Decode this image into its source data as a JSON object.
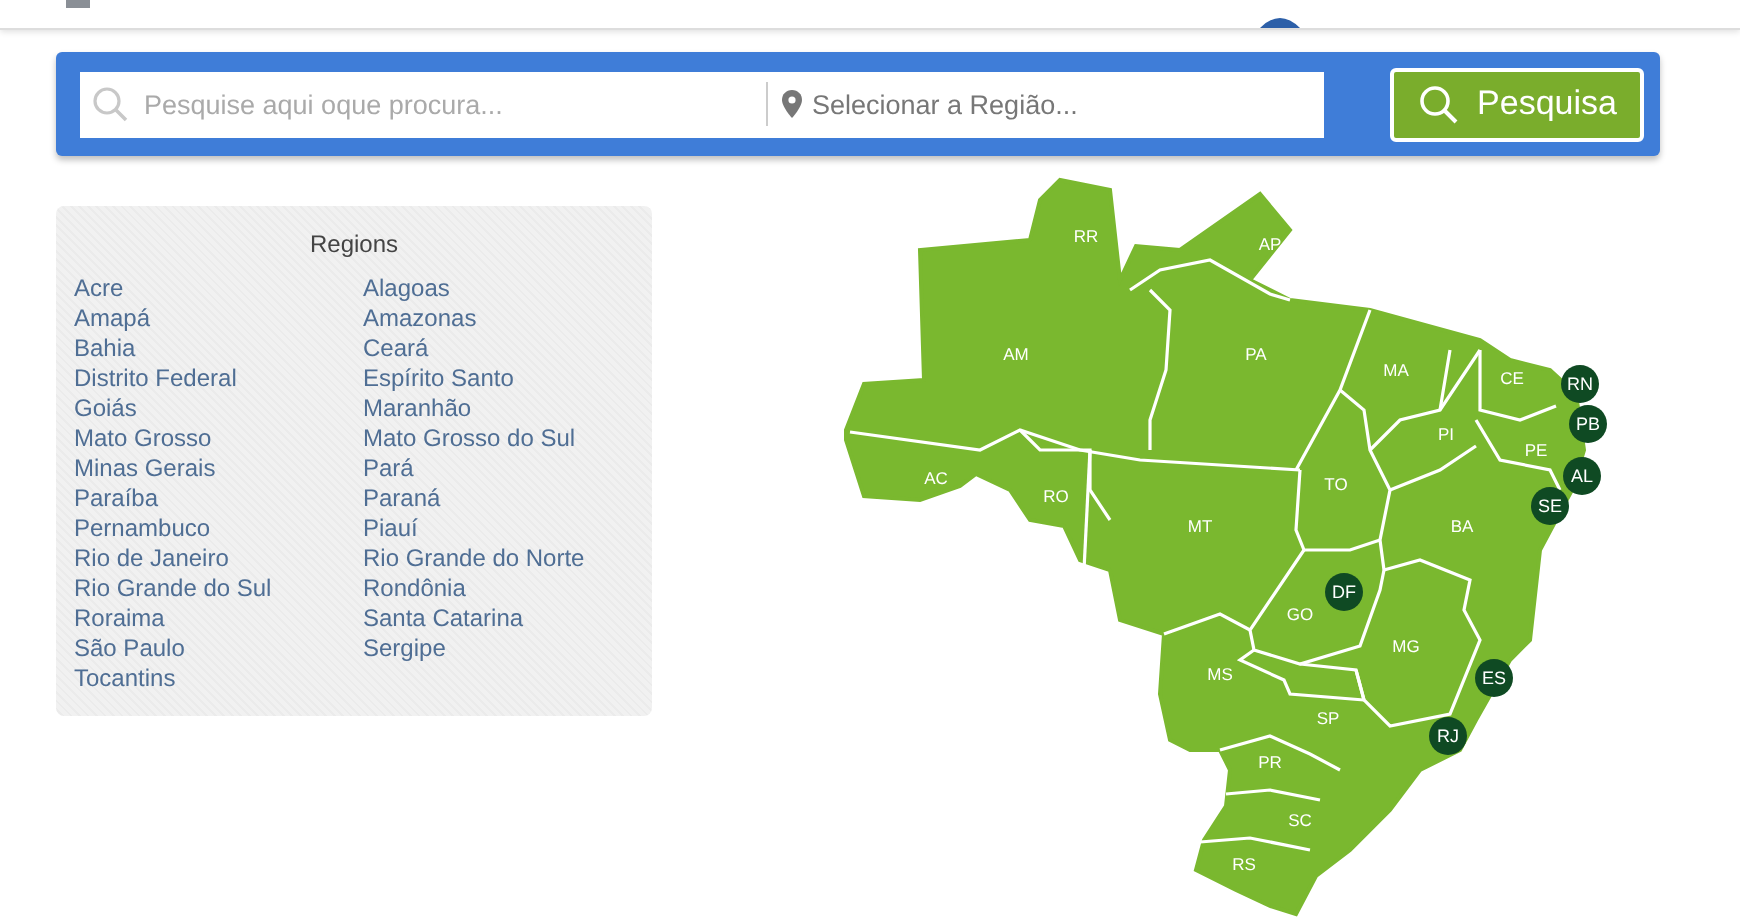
{
  "search": {
    "query_placeholder": "Pesquise aqui oque procura...",
    "region_placeholder": "Selecionar a Região...",
    "button": "Pesquisa"
  },
  "regions": {
    "title": "Regions",
    "columns": [
      [
        "Acre",
        "Amapá",
        "Bahia",
        "Distrito Federal",
        "Goiás",
        "Mato Grosso",
        "Minas Gerais",
        "Paraíba",
        "Pernambuco",
        "Rio de Janeiro",
        "Rio Grande do Sul",
        "Roraima",
        "São Paulo",
        "Tocantins"
      ],
      [
        "Alagoas",
        "Amazonas",
        "Ceará",
        "Espírito Santo",
        "Maranhão",
        "Mato Grosso do Sul",
        "Pará",
        "Paraná",
        "Piauí",
        "Rio Grande do Norte",
        "Rondônia",
        "Santa Catarina",
        "Sergipe"
      ]
    ]
  },
  "map": {
    "states": [
      {
        "label": "RR",
        "kind": "plain"
      },
      {
        "label": "AP",
        "kind": "plain"
      },
      {
        "label": "AM",
        "kind": "plain"
      },
      {
        "label": "PA",
        "kind": "plain"
      },
      {
        "label": "MA",
        "kind": "plain"
      },
      {
        "label": "CE",
        "kind": "plain"
      },
      {
        "label": "RN",
        "kind": "badge"
      },
      {
        "label": "PB",
        "kind": "badge"
      },
      {
        "label": "PI",
        "kind": "plain"
      },
      {
        "label": "PE",
        "kind": "plain"
      },
      {
        "label": "AL",
        "kind": "badge"
      },
      {
        "label": "AC",
        "kind": "plain"
      },
      {
        "label": "RO",
        "kind": "plain"
      },
      {
        "label": "TO",
        "kind": "plain"
      },
      {
        "label": "SE",
        "kind": "badge"
      },
      {
        "label": "MT",
        "kind": "plain"
      },
      {
        "label": "BA",
        "kind": "plain"
      },
      {
        "label": "DF",
        "kind": "badge"
      },
      {
        "label": "GO",
        "kind": "plain"
      },
      {
        "label": "MG",
        "kind": "plain"
      },
      {
        "label": "ES",
        "kind": "badge"
      },
      {
        "label": "MS",
        "kind": "plain"
      },
      {
        "label": "SP",
        "kind": "plain"
      },
      {
        "label": "RJ",
        "kind": "badge"
      },
      {
        "label": "PR",
        "kind": "plain"
      },
      {
        "label": "SC",
        "kind": "plain"
      },
      {
        "label": "RS",
        "kind": "plain"
      }
    ]
  }
}
